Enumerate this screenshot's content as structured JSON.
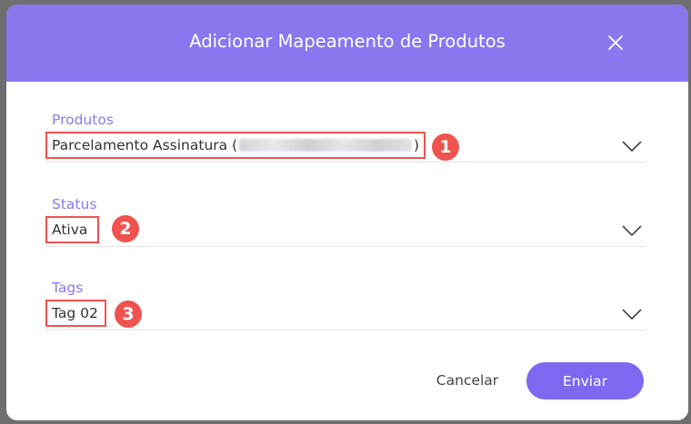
{
  "dialog": {
    "title": "Adicionar Mapeamento de Produtos",
    "close_icon": "close-icon"
  },
  "fields": [
    {
      "label": "Produtos",
      "value_prefix": "Parcelamento Assinatura (",
      "value_suffix": ")",
      "redacted": true,
      "annotation": "1"
    },
    {
      "label": "Status",
      "value": "Ativa",
      "annotation": "2"
    },
    {
      "label": "Tags",
      "value": "Tag 02",
      "annotation": "3"
    }
  ],
  "actions": {
    "cancel_label": "Cancelar",
    "submit_label": "Enviar"
  },
  "colors": {
    "header": "#8977ef",
    "label": "#8a78ee",
    "submit": "#7d68ef",
    "annotation": "#ef5350"
  }
}
